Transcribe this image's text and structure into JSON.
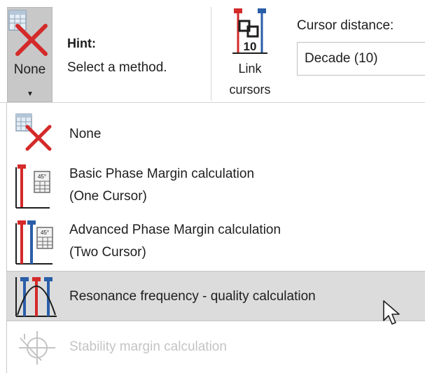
{
  "ribbon": {
    "method_button": {
      "label": "None",
      "icon": "none-method-icon"
    },
    "hint": {
      "title": "Hint:",
      "text": "Select a method."
    },
    "link_cursors": {
      "label_line1": "Link",
      "label_line2": "cursors",
      "badge": "10",
      "icon": "link-cursors-icon"
    },
    "cursor_distance": {
      "label": "Cursor distance:",
      "value": "Decade (10)"
    }
  },
  "menu": {
    "items": [
      {
        "line1": "None",
        "line2": "",
        "icon": "none-method-icon",
        "state": "normal"
      },
      {
        "line1": "Basic Phase Margin calculation",
        "line2": "(One Cursor)",
        "icon": "basic-phase-margin-icon",
        "state": "normal"
      },
      {
        "line1": "Advanced Phase Margin calculation",
        "line2": "(Two Cursor)",
        "icon": "advanced-phase-margin-icon",
        "state": "normal"
      },
      {
        "line1": "Resonance frequency - quality calculation",
        "line2": "",
        "icon": "resonance-icon",
        "state": "hover"
      },
      {
        "line1": "Stability margin calculation",
        "line2": "",
        "icon": "stability-margin-icon",
        "state": "disabled"
      }
    ]
  },
  "colors": {
    "red": "#d42a2a",
    "blue": "#2a5ea8",
    "hover_bg": "#dcdcdc",
    "button_pressed_bg": "#c8c8c8",
    "disabled_text": "#c4c4c4"
  },
  "icon_badges": {
    "phase": "45°"
  }
}
